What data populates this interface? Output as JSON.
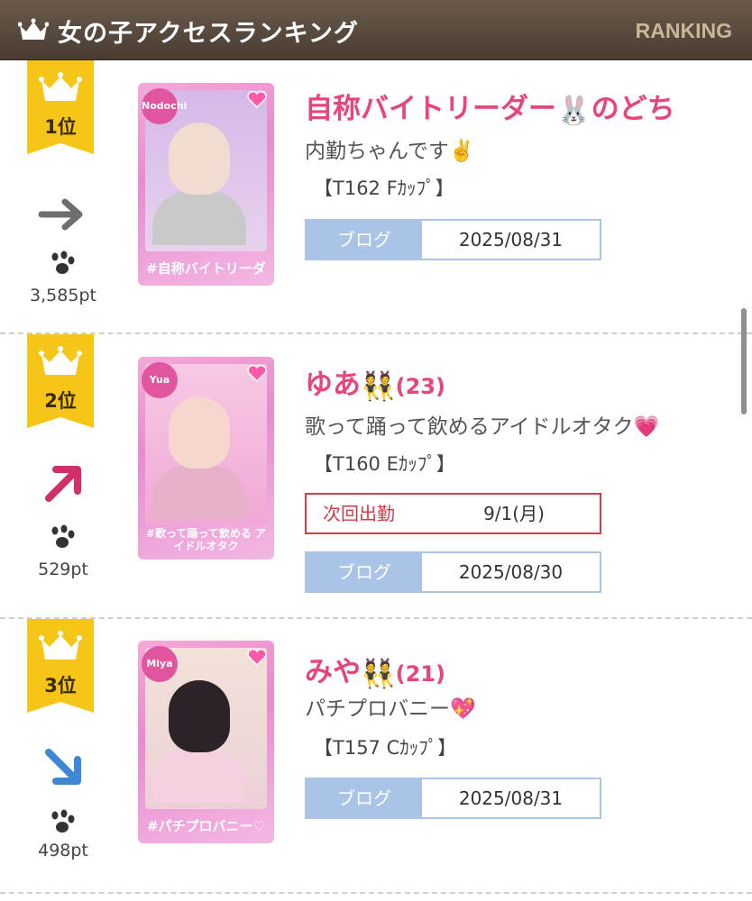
{
  "header": {
    "title": "女の子アクセスランキング",
    "subtitle": "RANKING"
  },
  "ranking": [
    {
      "rank": "1位",
      "trend": "right-arrow-icon",
      "points": "3,585pt",
      "photo_tag": "#自称バイトリーダー",
      "photo_name": "Nodochi",
      "name": "自称バイトリーダー",
      "name_emoji": "🐰",
      "name_suffix": "のどち",
      "age": "",
      "catch": "内勤ちゃんです✌️",
      "spec": "【T162 Fｶｯﾌﾟ】",
      "blog_label": "ブログ",
      "blog_date": "2025/08/31"
    },
    {
      "rank": "2位",
      "trend": "up-right-arrow-icon",
      "points": "529pt",
      "photo_tag": "#歌って踊って飲める アイドルオタク",
      "photo_name": "Yua",
      "name": "ゆあ",
      "name_emoji": "👯",
      "name_suffix": "",
      "age": "(23)",
      "catch": "歌って踊って飲めるアイドルオタク💗",
      "spec": "【T160 Eｶｯﾌﾟ】",
      "next_label": "次回出勤",
      "next_value": "9/1(月)",
      "blog_label": "ブログ",
      "blog_date": "2025/08/30"
    },
    {
      "rank": "3位",
      "trend": "down-right-arrow-icon",
      "points": "498pt",
      "photo_tag": "#パチプロバニー♡",
      "photo_name": "Miya",
      "name": "みや",
      "name_emoji": "👯",
      "name_suffix": "",
      "age": "(21)",
      "catch": "パチプロバニー💖",
      "spec": "【T157 Cｶｯﾌﾟ】",
      "blog_label": "ブログ",
      "blog_date": "2025/08/31"
    }
  ],
  "colors": {
    "header_bg": "#5a4a3e",
    "name_pink": "#e8447e",
    "badge_yellow": "#f5c518",
    "blog_blue": "#a9c4e7",
    "next_red": "#d23c48",
    "trend_gray": "#6e6e6e",
    "trend_pink": "#d0306a",
    "trend_blue": "#3d87d4"
  }
}
